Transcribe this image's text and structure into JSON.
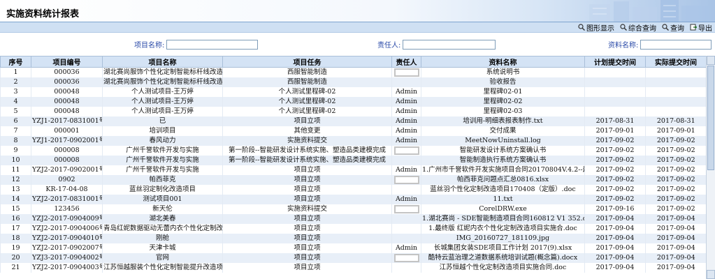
{
  "page": {
    "title": "实施资料统计报表"
  },
  "toolbar": {
    "buttons": [
      {
        "icon": "chart-icon",
        "label": "图形显示"
      },
      {
        "icon": "combined-search-icon",
        "label": "综合查询"
      },
      {
        "icon": "search-icon",
        "label": "查询"
      },
      {
        "icon": "export-icon",
        "label": "导出"
      }
    ]
  },
  "search": {
    "project_name_label": "项目名称:",
    "project_name_value": "",
    "responsible_label": "责任人:",
    "responsible_value": "",
    "doc_name_label": "资料名称:",
    "doc_name_value": ""
  },
  "table": {
    "columns": [
      "序号",
      "项目编号",
      "项目名称",
      "项目任务",
      "责任人",
      "资料名称",
      "计划提交时间",
      "实际提交时间"
    ],
    "rows": [
      [
        "1",
        "000036",
        "湖北赛尚服饰个性化定制智能标杆线改造工程",
        "西服智能制造",
        "[img]",
        "系统说明书",
        "",
        ""
      ],
      [
        "2",
        "000036",
        "湖北赛尚服饰个性化定制智能标杆线改造工程",
        "西服智能制造",
        "",
        "验收报告",
        "",
        ""
      ],
      [
        "3",
        "000048",
        "个人测试项目-王万婷",
        "个人测试里程碑-02",
        "Admin",
        "里程碑02-01",
        "",
        ""
      ],
      [
        "4",
        "000048",
        "个人测试项目-王万婷",
        "个人测试里程碑-02",
        "Admin",
        "里程碑02-02",
        "",
        ""
      ],
      [
        "5",
        "000048",
        "个人测试项目-王万婷",
        "个人测试里程碑-02",
        "Admin",
        "里程碑02-03",
        "",
        ""
      ],
      [
        "6",
        "YZJ1-2017-0831001号",
        "已",
        "项目立项",
        "Admin",
        "培训用-明细表报表制作.txt",
        "2017-08-31",
        "2017-08-31"
      ],
      [
        "7",
        "000001",
        "培训项目",
        "其他变更",
        "Admin",
        "交付成果",
        "2017-09-01",
        "2017-09-01"
      ],
      [
        "8",
        "YZJ1-2017-0902001号",
        "春风动力",
        "实施资料提交",
        "Admin",
        "MeetNowUninstall.log",
        "2017-09-02",
        "2017-09-02"
      ],
      [
        "9",
        "000008",
        "广州千誉软件开发与实施",
        "第一阶段--智能研发设计系统实施、塑造品类建模完成",
        "[img]",
        "智能研发设计系统方案确认书",
        "2017-09-02",
        "2017-09-02"
      ],
      [
        "10",
        "000008",
        "广州千誉软件开发与实施",
        "第一阶段--智能研发设计系统实施、塑造品类建模完成",
        "",
        "智能制造执行系统方案确认书",
        "2017-09-02",
        "2017-09-02"
      ],
      [
        "11",
        "YZJ2-2017-0902001号",
        "广州千誉软件开发与实施",
        "项目立项",
        "Admin",
        "1.广州市千誉软件开发实施项目合同20170804V.4.2--最终版.doc",
        "2017-09-02",
        "2017-09-02"
      ],
      [
        "12",
        "0902",
        "帕西菲克",
        "项目立项",
        "[img]",
        "帕西菲克问题点汇总0816.xlsx",
        "2017-09-02",
        "2017-09-02"
      ],
      [
        "13",
        "KR-17-04-08",
        "蓝丝羽定制化改造项目",
        "项目立项",
        "",
        "蓝丝羽个性化定制改造项目170408（定版）.doc",
        "2017-09-02",
        "2017-09-02"
      ],
      [
        "14",
        "YZJ2-2017-0831001号",
        "测试项目001",
        "项目立项",
        "Admin",
        "11.txt",
        "2017-09-02",
        "2017-09-02"
      ],
      [
        "15",
        "123456",
        "新天伦",
        "实施资料提交",
        "[img]",
        "CorelDRW.exe",
        "2017-09-16",
        "2017-09-02"
      ],
      [
        "16",
        "YZJ2-2017-0904009号",
        "湖北美春",
        "项目立项",
        "",
        "1.湖北赛尚 - SDE智能制造项目合同160812 V1 352.doc",
        "2017-09-04",
        "2017-09-04"
      ],
      [
        "17",
        "YZJ2-2017-0904006号",
        "青岛红妮数据驱动无蕾内衣个性化定制改造项目",
        "项目立项",
        "",
        "1.最终版 红妮内衣个性化定制改造项目实施合.doc",
        "2017-09-04",
        "2017-09-04"
      ],
      [
        "18",
        "YZJ2-2017-0904010号",
        "刚舱",
        "项目立项",
        "",
        "IMG_20160727_181109.jpg",
        "2017-09-04",
        "2017-09-04"
      ],
      [
        "19",
        "YZJ2-2017-0902007号",
        "天津卡城",
        "项目立项",
        "Admin",
        "长城集团女装SDE项目工作计划 2017(9).xlsx",
        "2017-09-04",
        "2017-09-04"
      ],
      [
        "20",
        "YZJ3-2017-0904002号",
        "官网",
        "项目立项",
        "[img]",
        "酷特云蓝治理之道数据系统培训试题(概念篇).docx",
        "2017-09-04",
        "2017-09-04"
      ],
      [
        "21",
        "YZJ2-2017-0904003号",
        "江苏恒越服装个性化定制智能提升改造项目",
        "项目立项",
        "",
        "江苏恒越个性化定制改造项目实施合同.doc",
        "2017-09-04",
        "2017-09-04"
      ]
    ]
  },
  "colors": {
    "header_bg": "#d4e3f5",
    "row_alt": "#e8eff8",
    "label_blue": "#2a4aa8",
    "title_grad_end": "#a9c4e6"
  }
}
